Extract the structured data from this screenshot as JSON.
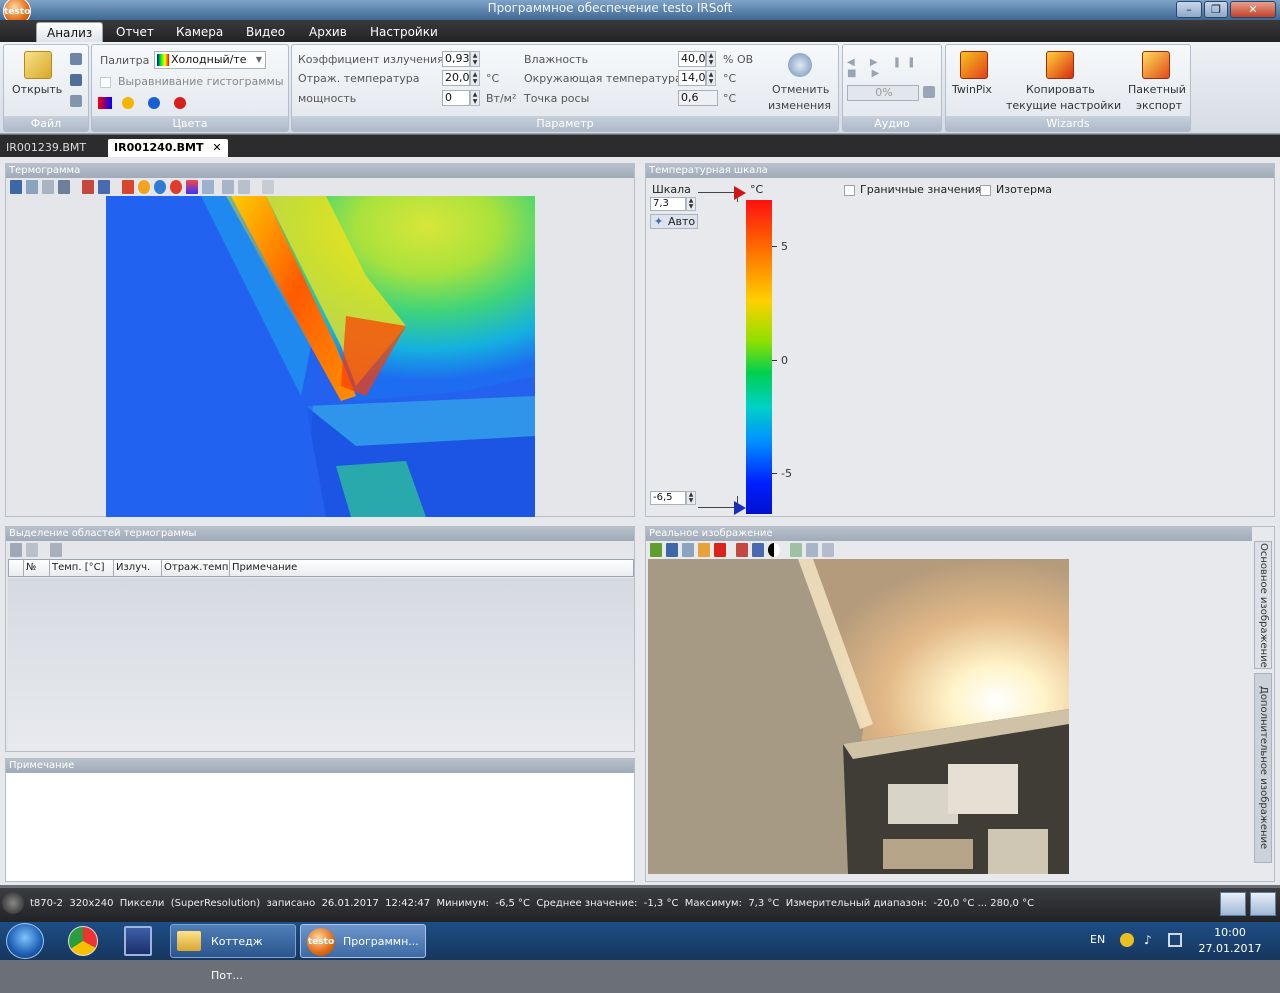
{
  "window": {
    "title": "Программное обеспечение testo IRSoft",
    "logo_text": "testo"
  },
  "menu": [
    "Анализ",
    "Отчет",
    "Камера",
    "Видео",
    "Архив",
    "Настройки"
  ],
  "ribbon": {
    "file": {
      "open_label": "Открыть",
      "group": "Файл"
    },
    "colors": {
      "palette_label": "Палитра",
      "palette_value": "Холодный/те",
      "equalize_label": "Выравнивание гистограммы",
      "group": "Цвета"
    },
    "params": {
      "emissivity_label": "Коэффициент излучения",
      "emissivity_value": "0,93",
      "refl_label": "Отраж. температура",
      "refl_value": "20,0",
      "refl_unit": "°C",
      "power_label": "мощность",
      "power_value": "0",
      "power_unit": "Вт/м²",
      "humidity_label": "Влажность",
      "humidity_value": "40,0",
      "humidity_unit": "% ОВ",
      "ambient_label": "Окружающая температура",
      "ambient_value": "14,0",
      "ambient_unit": "°C",
      "dew_label": "Точка росы",
      "dew_value": "0,6",
      "dew_unit": "°C",
      "undo_label1": "Отменить",
      "undo_label2": "изменения",
      "group": "Параметр"
    },
    "audio": {
      "progress": "0%",
      "group": "Аудио"
    },
    "wizards": {
      "twinpix": "TwinPix",
      "copy1": "Копировать",
      "copy2": "текущие настройки",
      "batch1": "Пакетный",
      "batch2": "экспорт",
      "group": "Wizards"
    }
  },
  "doc_tabs": [
    "IR001239.BMT",
    "IR001240.BMT"
  ],
  "panels": {
    "thermogram": "Термограмма",
    "scale": "Температурная шкала",
    "regions": "Выделение областей термограммы",
    "note": "Примечание",
    "real": "Реальное изображение"
  },
  "scale": {
    "label": "Шкала",
    "max": "7,3",
    "min": "-6,5",
    "auto": "Авто",
    "unit": "°C",
    "ticks": [
      "5",
      "0",
      "-5"
    ],
    "bounds_label": "Граничные значения",
    "isotherm_label": "Изотерма"
  },
  "regions_table": {
    "columns": [
      "№",
      "Темп. [°C]",
      "Излуч.",
      "Отраж.темп",
      "Примечание"
    ]
  },
  "side_tabs": [
    "Основное изображение",
    "Дополнительное изображение"
  ],
  "status": "t870-2  320x240  Пиксели  (SuperResolution)  записано  26.01.2017  12:42:47  Минимум:  -6,5 °C  Среднее значение:  -1,3 °C  Максимум:  7,3 °C  Измерительный диапазон:  -20,0 °C ... 280,0 °C",
  "taskbar": {
    "item1": "Коттедж Пот...",
    "item2": "Программн...",
    "item2_logo": "testo",
    "lang": "EN",
    "time": "10:00",
    "date": "27.01.2017"
  }
}
